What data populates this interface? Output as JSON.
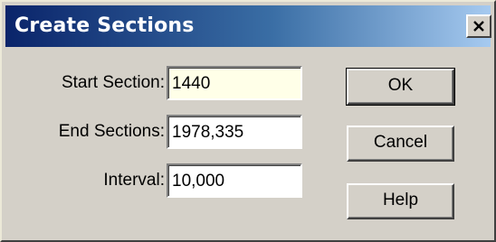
{
  "window": {
    "title": "Create Sections"
  },
  "title_bar": {
    "close_icon": "close-x-icon",
    "gradient_colors": [
      "#0a246a",
      "#a6caf0"
    ]
  },
  "form": {
    "start_section": {
      "label": "Start Section:",
      "value": "1440"
    },
    "end_sections": {
      "label": "End Sections:",
      "value": "1978,335"
    },
    "interval": {
      "label": "Interval:",
      "value": "10,000"
    }
  },
  "buttons": {
    "ok": "OK",
    "cancel": "Cancel",
    "help": "Help"
  }
}
